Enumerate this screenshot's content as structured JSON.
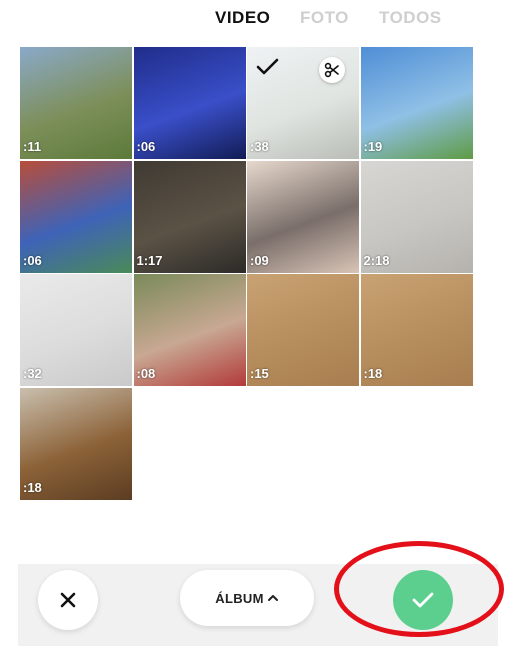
{
  "tabs": [
    {
      "label": "VIDEO",
      "active": true
    },
    {
      "label": "FOTO",
      "active": false
    },
    {
      "label": "TODOS",
      "active": false
    }
  ],
  "media": [
    {
      "duration": ":11",
      "colors": [
        "#8aa9c9",
        "#7d8f5a",
        "#5c7a3a"
      ],
      "selected": false
    },
    {
      "duration": ":06",
      "colors": [
        "#1f2d8a",
        "#3a4fc9",
        "#121c55"
      ],
      "selected": false
    },
    {
      "duration": ":38",
      "colors": [
        "#eef2f4",
        "#dfe4e0",
        "#b9bdb6"
      ],
      "selected": true
    },
    {
      "duration": ":19",
      "colors": [
        "#4f8ed6",
        "#8fc0e6",
        "#5f9b45"
      ],
      "selected": false
    },
    {
      "duration": ":06",
      "colors": [
        "#b84d3a",
        "#3e63b8",
        "#4a8a58"
      ],
      "selected": false
    },
    {
      "duration": "1:17",
      "colors": [
        "#3f3a33",
        "#5b5245",
        "#2c2b28"
      ],
      "selected": false
    },
    {
      "duration": ":09",
      "colors": [
        "#e6d8cc",
        "#7a6e6a",
        "#d9c4b6"
      ],
      "selected": false
    },
    {
      "duration": "2:18",
      "colors": [
        "#d7d6d3",
        "#c7c6c2",
        "#b5b2ad"
      ],
      "selected": false
    },
    {
      "duration": ":32",
      "colors": [
        "#eaeaea",
        "#dcdcdc",
        "#c9c9c9"
      ],
      "selected": false
    },
    {
      "duration": ":08",
      "colors": [
        "#7a8a5a",
        "#c8a892",
        "#b23a3a"
      ],
      "selected": false
    },
    {
      "duration": ":15",
      "colors": [
        "#c9a273",
        "#b68d5d",
        "#a87e50"
      ],
      "selected": false
    },
    {
      "duration": ":18",
      "colors": [
        "#c9a273",
        "#b68d5d",
        "#a87e50"
      ],
      "selected": false
    },
    {
      "duration": ":18",
      "colors": [
        "#c9bfae",
        "#8c6238",
        "#5b3d22"
      ],
      "selected": false
    }
  ],
  "buttons": {
    "close_icon": "close-icon",
    "album_label": "ÁLBUM",
    "album_icon": "chevron-up-icon",
    "confirm_icon": "checkmark-icon"
  },
  "colors": {
    "accent": "#5ccf8f",
    "highlight": "#e3101a",
    "tab_active": "#111111",
    "tab_inactive": "#cfcfcf"
  }
}
